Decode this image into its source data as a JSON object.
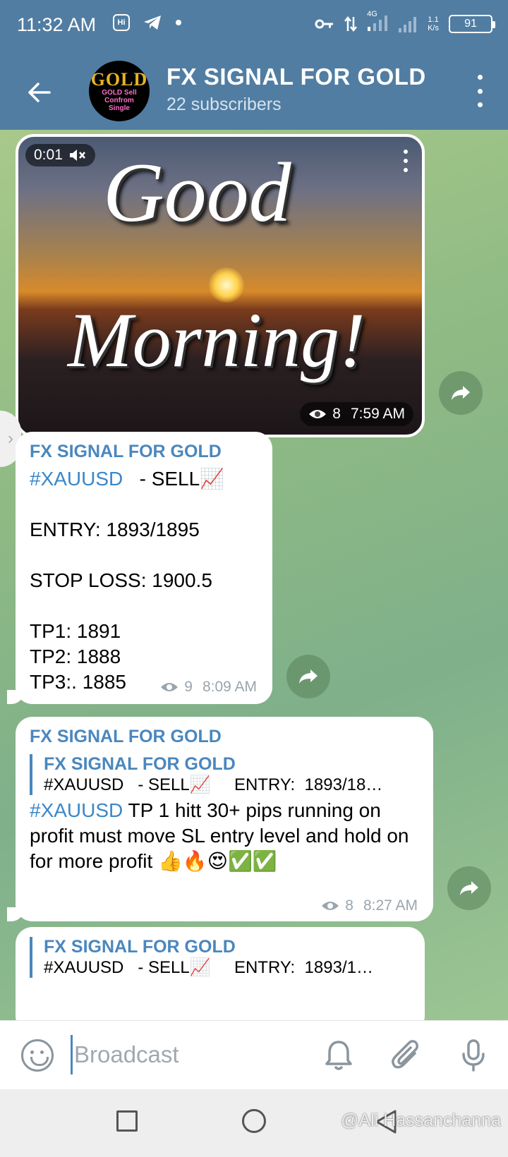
{
  "status": {
    "time": "11:32 AM",
    "hi_icon_text": "Hi",
    "network": "4G",
    "speed_value": "1.1",
    "speed_unit": "K/s",
    "battery": "91"
  },
  "header": {
    "title": "FX SIGNAL FOR GOLD",
    "subtitle": "22 subscribers",
    "avatar_text": "GOLD",
    "avatar_lines": [
      "GOLD Sell",
      "Confrom",
      "Single"
    ]
  },
  "messages": [
    {
      "type": "video",
      "duration": "0:01",
      "image_text_line1": "Good",
      "image_text_line2": "Morning!",
      "views": "8",
      "time": "7:59 AM"
    },
    {
      "type": "text",
      "author": "FX SIGNAL FOR GOLD",
      "hashtag": "#XAUUSD",
      "first_line_rest": "   - SELL📈",
      "body": "ENTRY:  1893/1895\n\nSTOP LOSS: 1900.5\n\nTP1:  1891\nTP2:  1888\nTP3:. 1885",
      "views": "9",
      "time": "8:09 AM"
    },
    {
      "type": "reply",
      "author": "FX SIGNAL FOR GOLD",
      "reply_author": "FX SIGNAL FOR GOLD",
      "reply_text": "#XAUUSD   - SELL📈     ENTRY:  1893/18…",
      "hashtag": "#XAUUSD",
      "body_rest": "  TP 1  hitt 30+ pips running on profit must move SL entry level and hold on for more profit 👍🔥😍✅✅",
      "views": "8",
      "time": "8:27 AM"
    },
    {
      "type": "reply-partial",
      "reply_author": "FX SIGNAL FOR GOLD",
      "reply_text": "#XAUUSD   - SELL📈     ENTRY:  1893/1…"
    }
  ],
  "composer": {
    "placeholder": "Broadcast"
  },
  "watermark": "@Ali Hassanchanna",
  "colors": {
    "header_bg": "#517da2",
    "author": "#4a87be",
    "hashtag": "#3a87c8"
  }
}
